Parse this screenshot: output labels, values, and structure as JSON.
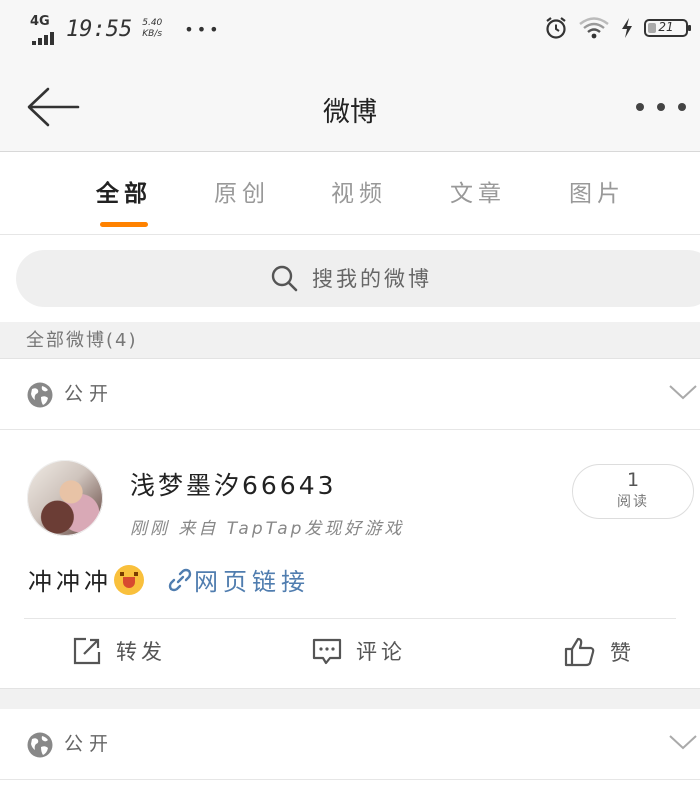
{
  "status_bar": {
    "network": "4G",
    "time": "19:55",
    "speed_value": "5.40",
    "speed_unit": "KB/s",
    "more_dots": "•••",
    "battery_level": "21"
  },
  "nav": {
    "title": "微博"
  },
  "tabs": [
    {
      "label": "全部",
      "active": true
    },
    {
      "label": "原创",
      "active": false
    },
    {
      "label": "视频",
      "active": false
    },
    {
      "label": "文章",
      "active": false
    },
    {
      "label": "图片",
      "active": false
    }
  ],
  "search": {
    "placeholder": "搜我的微博"
  },
  "section": {
    "heading": "全部微博(4)"
  },
  "posts": [
    {
      "visibility": "公开",
      "username": "浅梦墨汐66643",
      "meta": "刚刚 来自 TapTap发现好游戏",
      "read_count": "1",
      "read_label": "阅读",
      "text": "冲冲冲",
      "link_label": "网页链接",
      "actions": {
        "repost": "转发",
        "comment": "评论",
        "like": "赞"
      }
    },
    {
      "visibility": "公开"
    }
  ],
  "colors": {
    "accent": "#ff8200",
    "link": "#507daf",
    "background_gray": "#f1f1f1"
  },
  "icons": [
    "back-arrow-icon",
    "more-icon",
    "search-icon",
    "globe-icon",
    "chevron-down-icon",
    "link-icon",
    "repost-icon",
    "comment-icon",
    "like-icon",
    "alarm-icon",
    "wifi-icon",
    "charging-icon",
    "battery-icon"
  ]
}
